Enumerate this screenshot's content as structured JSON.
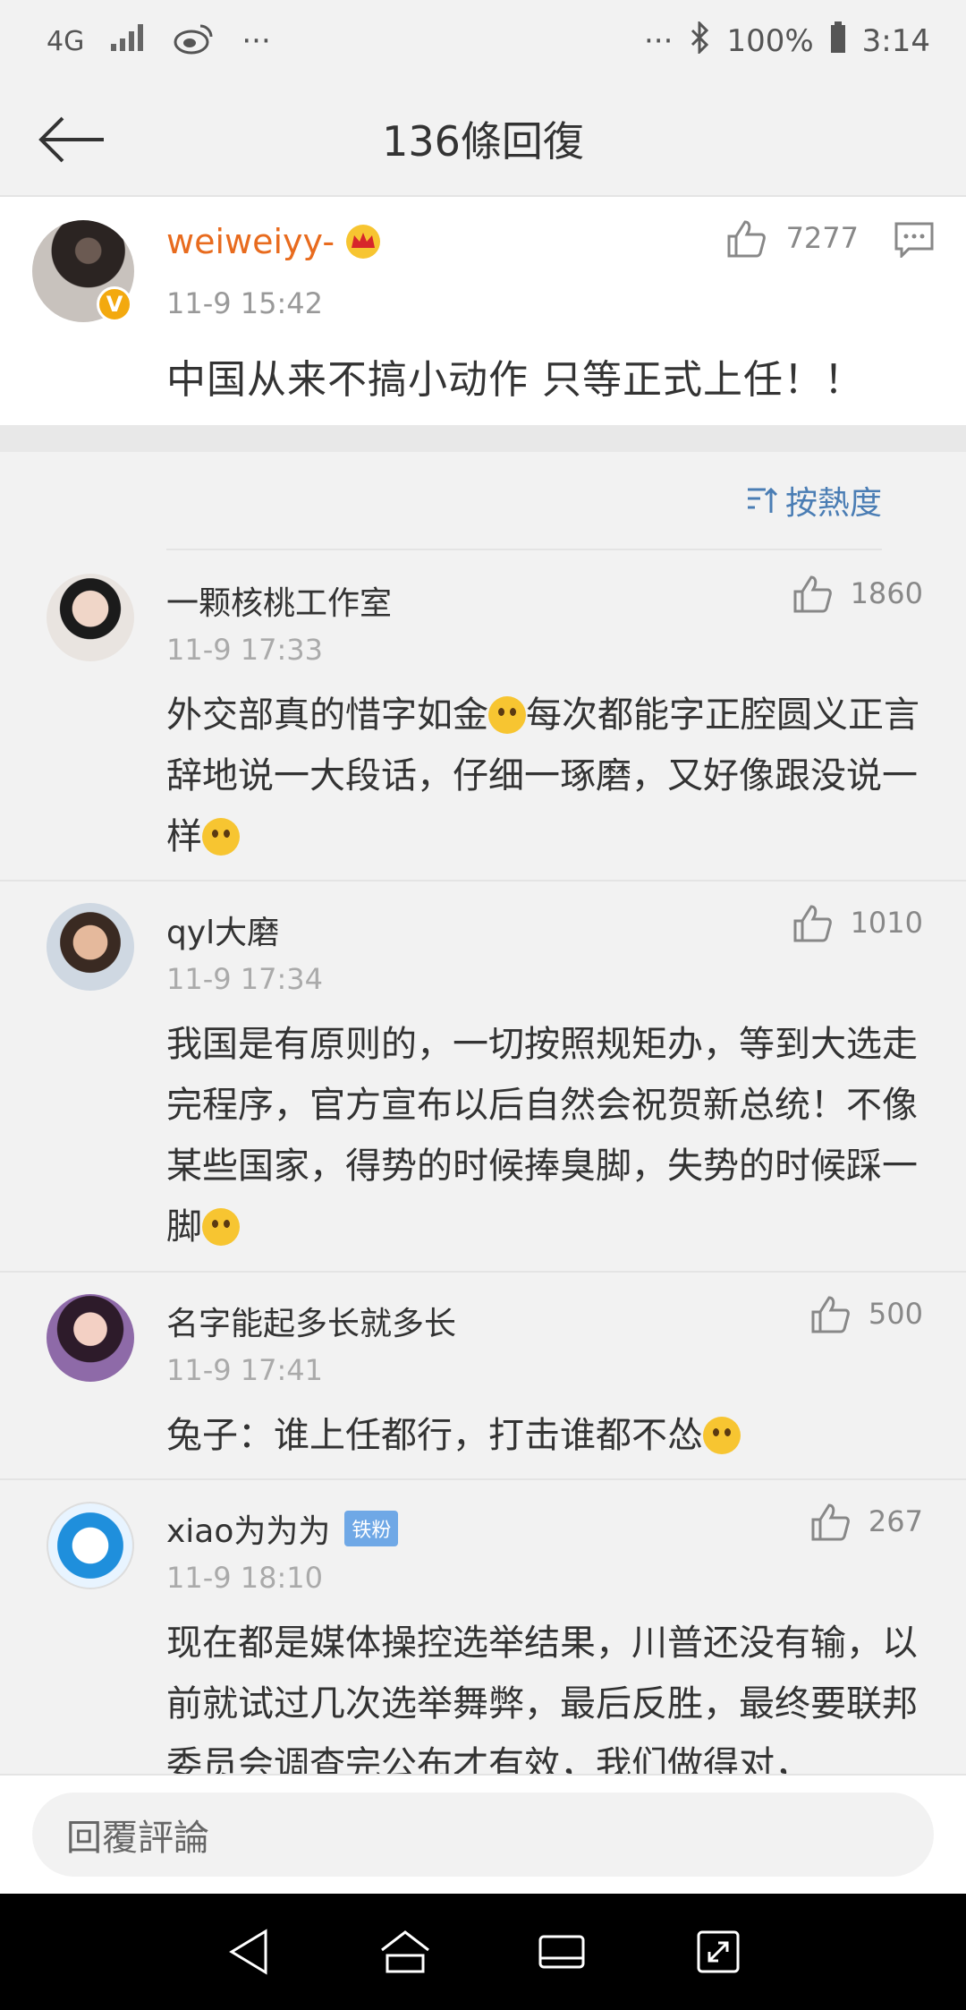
{
  "status_bar": {
    "network": "4G",
    "dots_left": "···",
    "dots_right": "···",
    "battery": "100%",
    "time": "3:14"
  },
  "nav": {
    "title": "136條回復"
  },
  "root_post": {
    "username": "weiweiyy-",
    "verified_badge": "V",
    "timestamp": "11-9 15:42",
    "text": "中国从来不搞小动作 只等正式上任！！",
    "likes": "7277"
  },
  "sort": {
    "label": "按熱度"
  },
  "comments": [
    {
      "username": "一颗核桃工作室",
      "timestamp": "11-9 17:33",
      "likes": "1860",
      "text_a": "外交部真的惜字如金",
      "text_b": "每次都能字正腔圆义正言辞地说一大段话，仔细一琢磨，又好像跟没说一样",
      "badge": ""
    },
    {
      "username": "qyl大磨",
      "timestamp": "11-9 17:34",
      "likes": "1010",
      "text_a": "我国是有原则的，一切按照规矩办，等到大选走完程序，官方宣布以后自然会祝贺新总统！不像某些国家，得势的时候捧臭脚，失势的时候踩一脚",
      "text_b": "",
      "badge": ""
    },
    {
      "username": "名字能起多长就多长",
      "timestamp": "11-9 17:41",
      "likes": "500",
      "text_a": "兔子：谁上任都行，打击谁都不怂",
      "text_b": "",
      "badge": ""
    },
    {
      "username": "xiao为为为",
      "timestamp": "11-9 18:10",
      "likes": "267",
      "text_a": "现在都是媒体操控选举结果，川普还没有输，以前就试过几次选举舞弊，最后反胜，最终要联邦委员会调查完公布才有效，我们做得对，",
      "text_b": "",
      "badge": "铁粉"
    }
  ],
  "bottom": {
    "reply_placeholder": "回覆評論"
  },
  "colors": {
    "username_orange": "#e86b1e",
    "sort_blue": "#4a7db4",
    "badge_gold": "#f3a90f"
  }
}
